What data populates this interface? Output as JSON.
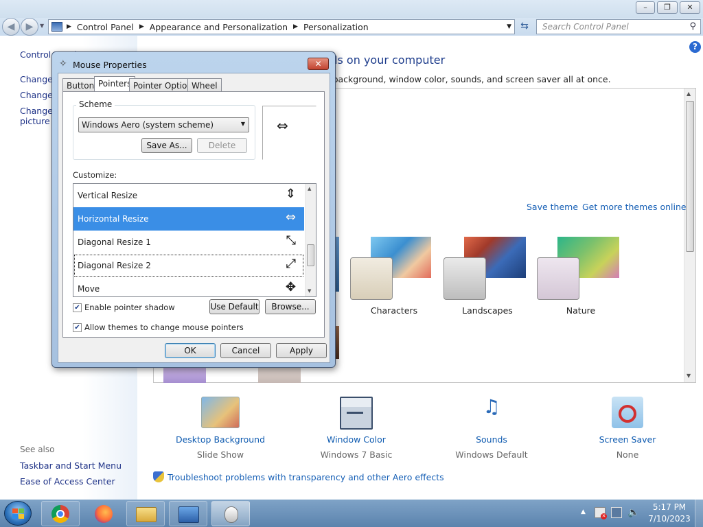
{
  "window": {
    "min": "–",
    "max": "❐",
    "close": "✕"
  },
  "nav": {
    "breadcrumbs": [
      "Control Panel",
      "Appearance and Personalization",
      "Personalization"
    ],
    "search_placeholder": "Search Control Panel"
  },
  "left_pane": {
    "home": "Control Panel Home",
    "links": [
      "Change desktop icons",
      "Change mouse pointers",
      "Change your account picture"
    ],
    "see_also_title": "See also",
    "see_also": [
      "Taskbar and Start Menu",
      "Ease of Access Center"
    ]
  },
  "main": {
    "heading": "Change the visuals and sounds on your computer",
    "subheading": "Click a theme to change the desktop background, window color, sounds, and screen saver all at once.",
    "save_theme": "Save theme",
    "get_more": "Get more themes online",
    "themes": [
      {
        "label": "Characters"
      },
      {
        "label": "Landscapes"
      },
      {
        "label": "Nature"
      }
    ],
    "bottom": [
      {
        "title": "Desktop Background",
        "sub": "Slide Show"
      },
      {
        "title": "Window Color",
        "sub": "Windows 7 Basic"
      },
      {
        "title": "Sounds",
        "sub": "Windows Default"
      },
      {
        "title": "Screen Saver",
        "sub": "None"
      }
    ],
    "troubleshoot": "Troubleshoot problems with transparency and other Aero effects"
  },
  "dialog": {
    "title": "Mouse Properties",
    "tabs": [
      "Buttons",
      "Pointers",
      "Pointer Options",
      "Wheel"
    ],
    "scheme_label": "Scheme",
    "scheme_value": "Windows Aero (system scheme)",
    "save_as": "Save As...",
    "delete": "Delete",
    "customize": "Customize:",
    "rows": [
      {
        "name": "Vertical Resize",
        "cursor": "⇕"
      },
      {
        "name": "Horizontal Resize",
        "cursor": "⇔"
      },
      {
        "name": "Diagonal Resize 1",
        "cursor": "⤡"
      },
      {
        "name": "Diagonal Resize 2",
        "cursor": "⤢"
      },
      {
        "name": "Move",
        "cursor": "✥"
      }
    ],
    "enable_shadow": "Enable pointer shadow",
    "allow_themes": "Allow themes to change mouse pointers",
    "use_default": "Use Default",
    "browse": "Browse...",
    "ok": "OK",
    "cancel": "Cancel",
    "apply": "Apply",
    "preview_cursor": "⇔"
  },
  "taskbar": {
    "time": "5:17 PM",
    "date": "7/10/2023",
    "tray_arrow": "▲"
  }
}
